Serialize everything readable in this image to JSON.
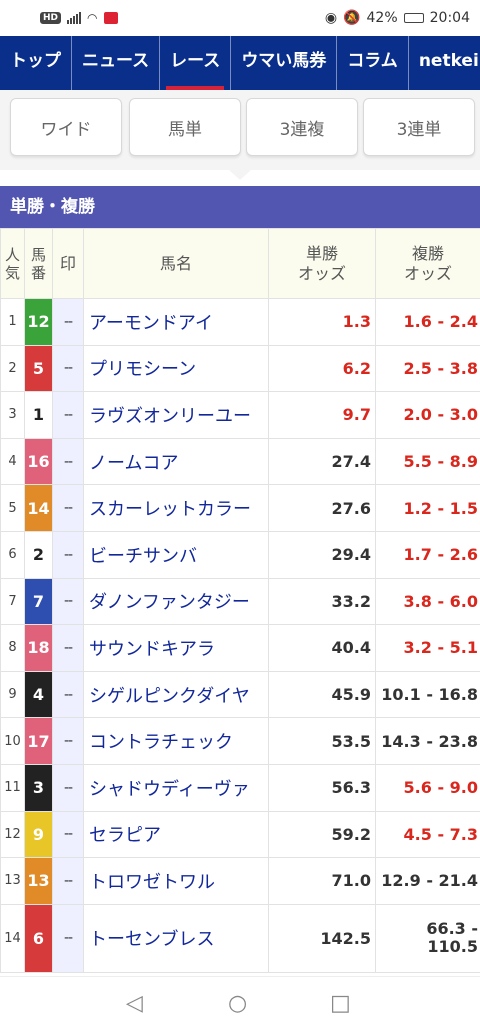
{
  "status": {
    "battery": "42%",
    "time": "20:04",
    "hd": "HD"
  },
  "nav": {
    "tabs": [
      "トップ",
      "ニュース",
      "レース",
      "ウマい馬券",
      "コラム",
      "netkeiba"
    ],
    "active": 2
  },
  "bet_types": [
    "ワイド",
    "馬単",
    "3連複",
    "3連単"
  ],
  "section_title": "単勝・複勝",
  "table": {
    "headers": {
      "rank": "人気",
      "num": "馬番",
      "mark": "印",
      "name": "馬名",
      "win": "単勝オッズ",
      "place": "複勝オッズ"
    },
    "rows": [
      {
        "rank": "1",
        "num": "12",
        "color": "#3aa43a",
        "mark": "--",
        "name": "アーモンドアイ",
        "win": "1.3",
        "place": "1.6 - 2.4",
        "win_red": true,
        "place_red": true
      },
      {
        "rank": "2",
        "num": "5",
        "color": "#d63a3a",
        "mark": "--",
        "name": "プリモシーン",
        "win": "6.2",
        "place": "2.5 - 3.8",
        "win_red": true,
        "place_red": true
      },
      {
        "rank": "3",
        "num": "1",
        "color": "#ffffff",
        "mark": "--",
        "name": "ラヴズオンリーユー",
        "win": "9.7",
        "place": "2.0 - 3.0",
        "win_red": true,
        "place_red": true
      },
      {
        "rank": "4",
        "num": "16",
        "color": "#e0627a",
        "mark": "--",
        "name": "ノームコア",
        "win": "27.4",
        "place": "5.5 - 8.9",
        "win_red": false,
        "place_red": true
      },
      {
        "rank": "5",
        "num": "14",
        "color": "#e08a28",
        "mark": "--",
        "name": "スカーレットカラー",
        "win": "27.6",
        "place": "1.2 - 1.5",
        "win_red": false,
        "place_red": true
      },
      {
        "rank": "6",
        "num": "2",
        "color": "#ffffff",
        "mark": "--",
        "name": "ビーチサンバ",
        "win": "29.4",
        "place": "1.7 - 2.6",
        "win_red": false,
        "place_red": true
      },
      {
        "rank": "7",
        "num": "7",
        "color": "#2f4fb0",
        "mark": "--",
        "name": "ダノンファンタジー",
        "win": "33.2",
        "place": "3.8 - 6.0",
        "win_red": false,
        "place_red": true
      },
      {
        "rank": "8",
        "num": "18",
        "color": "#e0627a",
        "mark": "--",
        "name": "サウンドキアラ",
        "win": "40.4",
        "place": "3.2 - 5.1",
        "win_red": false,
        "place_red": true
      },
      {
        "rank": "9",
        "num": "4",
        "color": "#222222",
        "mark": "--",
        "name": "シゲルピンクダイヤ",
        "win": "45.9",
        "place": "10.1 - 16.8",
        "win_red": false,
        "place_red": false
      },
      {
        "rank": "10",
        "num": "17",
        "color": "#e0627a",
        "mark": "--",
        "name": "コントラチェック",
        "win": "53.5",
        "place": "14.3 - 23.8",
        "win_red": false,
        "place_red": false
      },
      {
        "rank": "11",
        "num": "3",
        "color": "#222222",
        "mark": "--",
        "name": "シャドウディーヴァ",
        "win": "56.3",
        "place": "5.6 - 9.0",
        "win_red": false,
        "place_red": true
      },
      {
        "rank": "12",
        "num": "9",
        "color": "#e8c628",
        "mark": "--",
        "name": "セラピア",
        "win": "59.2",
        "place": "4.5 - 7.3",
        "win_red": false,
        "place_red": true
      },
      {
        "rank": "13",
        "num": "13",
        "color": "#e08a28",
        "mark": "--",
        "name": "トロワゼトワル",
        "win": "71.0",
        "place": "12.9 - 21.4",
        "win_red": false,
        "place_red": false
      },
      {
        "rank": "14",
        "num": "6",
        "color": "#d63a3a",
        "mark": "--",
        "name": "トーセンブレス",
        "win": "142.5",
        "place": "66.3 - 110.5",
        "win_red": false,
        "place_red": false
      }
    ]
  }
}
